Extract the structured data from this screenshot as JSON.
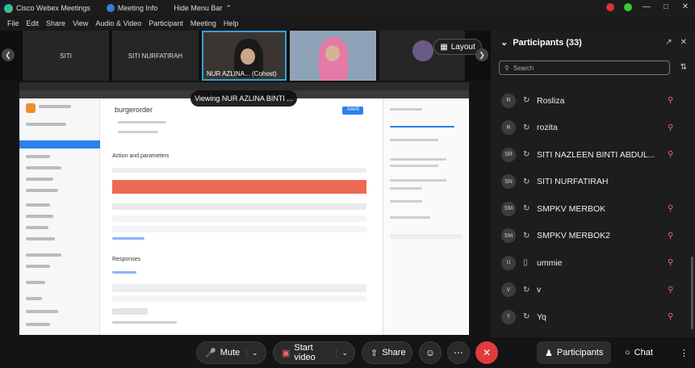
{
  "window": {
    "app_title": "Cisco Webex Meetings",
    "meeting_info": "Meeting Info",
    "hide_menu": "Hide Menu Bar"
  },
  "menu": [
    "File",
    "Edit",
    "Share",
    "View",
    "Audio & Video",
    "Participant",
    "Meeting",
    "Help"
  ],
  "filmstrip": {
    "tile1": "SITI",
    "tile2": "SITI NURFATIRAH",
    "tile3": "NUR AZLINA... (Cohost)",
    "layout": "Layout"
  },
  "share": {
    "viewing": "Viewing NUR AZLINA BINTI ...",
    "page_heading": "burgerorder",
    "section_action": "Action and parameters",
    "section_response": "Responses",
    "save_label": "SAVE"
  },
  "participants": {
    "title": "Participants (33)",
    "search_placeholder": "Search",
    "list": [
      {
        "initials": "R",
        "name": "Rosliza"
      },
      {
        "initials": "R",
        "name": "rozita"
      },
      {
        "initials": "SR",
        "name": "SITI NAZLEEN BINTI ABDUL..."
      },
      {
        "initials": "SN",
        "name": "SITI NURFATIRAH"
      },
      {
        "initials": "SM",
        "name": "SMPKV MERBOK"
      },
      {
        "initials": "SM",
        "name": "SMPKV MERBOK2"
      },
      {
        "initials": "U",
        "name": "ummie"
      },
      {
        "initials": "V",
        "name": "v"
      },
      {
        "initials": "Y",
        "name": "Yq"
      }
    ]
  },
  "controls": {
    "mute": "Mute",
    "start_video": "Start video",
    "share": "Share",
    "participants": "Participants",
    "chat": "Chat"
  },
  "colors": {
    "accent_blue": "#2fa3d8",
    "end_red": "#e03c3c",
    "mic_muted": "#e66666"
  }
}
